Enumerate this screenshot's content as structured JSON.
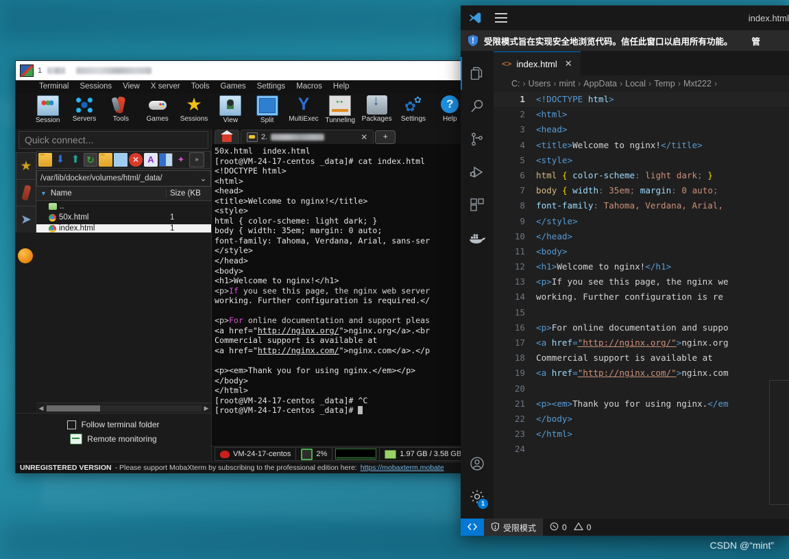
{
  "desktop": {
    "watermark": "CSDN @“mint”"
  },
  "mobaxterm": {
    "title_text": "1",
    "menu": [
      "Terminal",
      "Sessions",
      "View",
      "X server",
      "Tools",
      "Games",
      "Settings",
      "Macros",
      "Help"
    ],
    "toolbar": [
      {
        "label": "Session",
        "icon": "session-icon"
      },
      {
        "label": "Servers",
        "icon": "servers-icon"
      },
      {
        "label": "Tools",
        "icon": "tools-icon"
      },
      {
        "label": "Games",
        "icon": "games-icon"
      },
      {
        "label": "Sessions",
        "icon": "sessions-star-icon"
      },
      {
        "label": "View",
        "icon": "view-icon"
      },
      {
        "label": "Split",
        "icon": "split-icon"
      },
      {
        "label": "MultiExec",
        "icon": "multiexec-icon"
      },
      {
        "label": "Tunneling",
        "icon": "tunneling-icon"
      },
      {
        "label": "Packages",
        "icon": "packages-icon"
      },
      {
        "label": "Settings",
        "icon": "settings-icon"
      },
      {
        "label": "Help",
        "icon": "help-icon"
      }
    ],
    "quick_connect_placeholder": "Quick connect...",
    "sidebar_icons": [
      "star-icon",
      "tools-knife-icon",
      "paper-plane-icon",
      "globe-icon"
    ],
    "file_browser": {
      "toolbar_icons": [
        "up-folder-icon",
        "download-icon",
        "upload-icon",
        "refresh-icon",
        "new-folder-icon",
        "new-file-icon",
        "delete-icon",
        "rename-icon",
        "split-view-icon",
        "magic-icon",
        "more-icon"
      ],
      "path": "/var/lib/docker/volumes/html/_data/",
      "columns": [
        "Name",
        "Size (KB"
      ],
      "rows": [
        {
          "name": "..",
          "size": "",
          "icon": "up-folder-icon",
          "selected": false
        },
        {
          "name": "50x.html",
          "size": "1",
          "icon": "chrome-icon",
          "selected": false
        },
        {
          "name": "index.html",
          "size": "1",
          "icon": "chrome-icon",
          "selected": true
        }
      ]
    },
    "footer_options": [
      {
        "label": "Follow terminal folder",
        "control": "checkbox"
      },
      {
        "label": "Remote monitoring",
        "control": "icon"
      }
    ],
    "terminal": {
      "tabs": [
        {
          "label": "",
          "icon": "home-icon",
          "type": "home"
        },
        {
          "label": "2.",
          "icon": "key-icon",
          "type": "session",
          "redacted": true
        }
      ],
      "new_tab_label": "+",
      "lines": [
        "50x.html  index.html",
        "[root@VM-24-17-centos _data]# cat index.html",
        "<!DOCTYPE html>",
        "<html>",
        "<head>",
        "<title>Welcome to nginx!</title>",
        "<style>",
        "html { color-scheme: light dark; }",
        "body { width: 35em; margin: 0 auto;",
        "font-family: Tahoma, Verdana, Arial, sans-ser",
        "</style>",
        "</head>",
        "<body>",
        "<h1>Welcome to nginx!</h1>",
        "<p>If you see this page, the nginx web server",
        "working. Further configuration is required.</",
        "",
        "<p>For online documentation and support pleas",
        "<a href=\"http://nginx.org/\">nginx.org</a>.<br",
        "Commercial support is available at",
        "<a href=\"http://nginx.com/\">nginx.com</a>.</p",
        "",
        "<p><em>Thank you for using nginx.</em></p>",
        "</body>",
        "</html>",
        "[root@VM-24-17-centos _data]# ^C",
        "[root@VM-24-17-centos _data]# "
      ]
    },
    "status_bar": [
      {
        "label": "VM-24-17-centos",
        "icon": "redhat-icon"
      },
      {
        "label": "2%",
        "icon": "cpu-icon"
      },
      {
        "label": "",
        "icon": "graph-icon"
      },
      {
        "label": "1.97 GB / 3.58 GB",
        "icon": "ram-icon"
      }
    ],
    "unregistered": {
      "badge": "UNREGISTERED VERSION",
      "text": "- Please support MobaXterm by subscribing to the professional edition here:",
      "url": "https://mobaxterm.mobate"
    }
  },
  "vscode": {
    "title": "index.html",
    "trust_banner": {
      "message": "受限模式旨在实现安全地浏览代码。信任此窗口以启用所有功能。",
      "manage": "管",
      "icon": "shield-icon"
    },
    "activity_bar": [
      {
        "name": "explorer-icon",
        "selected": true
      },
      {
        "name": "search-icon",
        "selected": false
      },
      {
        "name": "source-control-icon",
        "selected": false
      },
      {
        "name": "run-debug-icon",
        "selected": false
      },
      {
        "name": "extensions-icon",
        "selected": false
      },
      {
        "name": "docker-icon",
        "selected": false
      }
    ],
    "activity_bar_bottom": [
      {
        "name": "account-icon",
        "badge": ""
      },
      {
        "name": "settings-gear-icon",
        "badge": "1"
      }
    ],
    "tab": {
      "label": "index.html",
      "icon": "html-code-icon",
      "close": "✕"
    },
    "breadcrumb": [
      "C:",
      "Users",
      "mint",
      "AppData",
      "Local",
      "Temp",
      "Mxt222"
    ],
    "breadcrumb_separator": "›",
    "editor_lines": [
      {
        "n": "1",
        "cur": true,
        "tokens": [
          {
            "t": "tag",
            "v": "<!DOCTYPE "
          },
          {
            "t": "name",
            "v": "html"
          },
          {
            "t": "tag",
            "v": ">"
          }
        ]
      },
      {
        "n": "2",
        "cur": false,
        "tokens": [
          {
            "t": "tag",
            "v": "<html>"
          }
        ]
      },
      {
        "n": "3",
        "cur": false,
        "tokens": [
          {
            "t": "tag",
            "v": "<head>"
          }
        ]
      },
      {
        "n": "4",
        "cur": false,
        "tokens": [
          {
            "t": "tag",
            "v": "<title>"
          },
          {
            "t": "txt",
            "v": "Welcome to nginx!"
          },
          {
            "t": "tag",
            "v": "</title>"
          }
        ]
      },
      {
        "n": "5",
        "cur": false,
        "tokens": [
          {
            "t": "tag",
            "v": "<style>"
          }
        ]
      },
      {
        "n": "6",
        "cur": false,
        "tokens": [
          {
            "t": "sel",
            "v": "html"
          },
          {
            "t": "txt",
            "v": " "
          },
          {
            "t": "brace",
            "v": "{"
          },
          {
            "t": "txt",
            "v": " "
          },
          {
            "t": "prop",
            "v": "color-scheme"
          },
          {
            "t": "punct",
            "v": ": "
          },
          {
            "t": "val",
            "v": "light dark"
          },
          {
            "t": "punct",
            "v": "; "
          },
          {
            "t": "brace",
            "v": "}"
          }
        ]
      },
      {
        "n": "7",
        "cur": false,
        "tokens": [
          {
            "t": "sel",
            "v": "body"
          },
          {
            "t": "txt",
            "v": " "
          },
          {
            "t": "brace",
            "v": "{"
          },
          {
            "t": "txt",
            "v": " "
          },
          {
            "t": "prop",
            "v": "width"
          },
          {
            "t": "punct",
            "v": ": "
          },
          {
            "t": "val",
            "v": "35em"
          },
          {
            "t": "punct",
            "v": "; "
          },
          {
            "t": "prop",
            "v": "margin"
          },
          {
            "t": "punct",
            "v": ": "
          },
          {
            "t": "val",
            "v": "0 auto"
          },
          {
            "t": "punct",
            "v": ";"
          }
        ]
      },
      {
        "n": "8",
        "cur": false,
        "tokens": [
          {
            "t": "prop",
            "v": "font-family"
          },
          {
            "t": "punct",
            "v": ": "
          },
          {
            "t": "val",
            "v": "Tahoma, Verdana, Arial,"
          }
        ]
      },
      {
        "n": "9",
        "cur": false,
        "tokens": [
          {
            "t": "tag",
            "v": "</style>"
          }
        ]
      },
      {
        "n": "10",
        "cur": false,
        "tokens": [
          {
            "t": "tag",
            "v": "</head>"
          }
        ]
      },
      {
        "n": "11",
        "cur": false,
        "tokens": [
          {
            "t": "tag",
            "v": "<body>"
          }
        ]
      },
      {
        "n": "12",
        "cur": false,
        "tokens": [
          {
            "t": "tag",
            "v": "<h1>"
          },
          {
            "t": "txt",
            "v": "Welcome to nginx!"
          },
          {
            "t": "tag",
            "v": "</h1>"
          }
        ]
      },
      {
        "n": "13",
        "cur": false,
        "tokens": [
          {
            "t": "tag",
            "v": "<p>"
          },
          {
            "t": "txt",
            "v": "If you see this page, the nginx we"
          }
        ]
      },
      {
        "n": "14",
        "cur": false,
        "tokens": [
          {
            "t": "txt",
            "v": "working. Further configuration is re"
          }
        ]
      },
      {
        "n": "15",
        "cur": false,
        "tokens": []
      },
      {
        "n": "16",
        "cur": false,
        "tokens": [
          {
            "t": "tag",
            "v": "<p>"
          },
          {
            "t": "txt",
            "v": "For online documentation and suppo"
          }
        ]
      },
      {
        "n": "17",
        "cur": false,
        "tokens": [
          {
            "t": "tag",
            "v": "<a "
          },
          {
            "t": "attr",
            "v": "href"
          },
          {
            "t": "tag",
            "v": "="
          },
          {
            "t": "strlink",
            "v": "\"http://nginx.org/\""
          },
          {
            "t": "tag",
            "v": ">"
          },
          {
            "t": "txt",
            "v": "nginx.org"
          }
        ]
      },
      {
        "n": "18",
        "cur": false,
        "tokens": [
          {
            "t": "txt",
            "v": "Commercial support is available at"
          }
        ]
      },
      {
        "n": "19",
        "cur": false,
        "tokens": [
          {
            "t": "tag",
            "v": "<a "
          },
          {
            "t": "attr",
            "v": "href"
          },
          {
            "t": "tag",
            "v": "="
          },
          {
            "t": "strlink",
            "v": "\"http://nginx.com/\""
          },
          {
            "t": "tag",
            "v": ">"
          },
          {
            "t": "txt",
            "v": "nginx.com"
          }
        ]
      },
      {
        "n": "20",
        "cur": false,
        "tokens": []
      },
      {
        "n": "21",
        "cur": false,
        "tokens": [
          {
            "t": "tag",
            "v": "<p><em>"
          },
          {
            "t": "txt",
            "v": "Thank you for using nginx."
          },
          {
            "t": "tag",
            "v": "</em"
          }
        ]
      },
      {
        "n": "22",
        "cur": false,
        "tokens": [
          {
            "t": "tag",
            "v": "</body>"
          }
        ]
      },
      {
        "n": "23",
        "cur": false,
        "tokens": [
          {
            "t": "tag",
            "v": "</html>"
          }
        ]
      },
      {
        "n": "24",
        "cur": false,
        "tokens": []
      }
    ],
    "status_bar": {
      "remote_label": "",
      "trust_label": "受限模式",
      "errors": "0",
      "warnings": "0"
    }
  }
}
